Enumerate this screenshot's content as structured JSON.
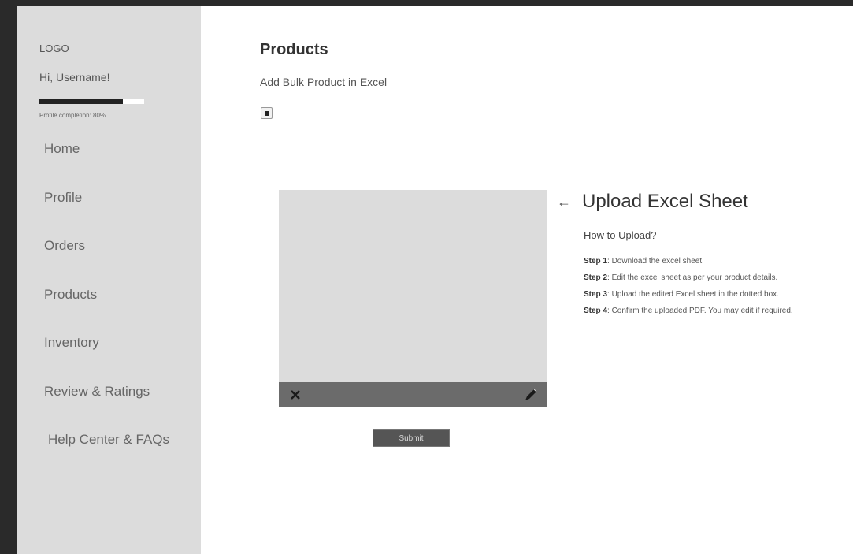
{
  "sidebar": {
    "logo": "LOGO",
    "greeting": "Hi, Username!",
    "profile_completion": {
      "value": 0.8,
      "label": "Profile completion: 80%"
    },
    "nav": [
      {
        "label": "Home"
      },
      {
        "label": "Profile"
      },
      {
        "label": "Orders"
      },
      {
        "label": "Products"
      },
      {
        "label": "Inventory"
      },
      {
        "label": "Review & Ratings"
      },
      {
        "label": "Help Center & FAQs"
      }
    ]
  },
  "main": {
    "title": "Products",
    "subtitle": "Add Bulk Product in Excel",
    "upload": {
      "heading": "Upload Excel Sheet",
      "how_to": "How to Upload?",
      "steps": [
        {
          "label": "Step 1",
          "text": "Download the excel sheet."
        },
        {
          "label": "Step 2",
          "text": "Edit the excel sheet as per your product details."
        },
        {
          "label": "Step 3",
          "text": "Upload the edited Excel sheet in the dotted box."
        },
        {
          "label": "Step 4",
          "text": "Confirm the uploaded PDF. You may edit if required."
        }
      ]
    },
    "submit_label": "Submit"
  },
  "icons": {
    "back": "left-arrow-icon",
    "remove": "close-icon",
    "edit": "pencil-icon",
    "checkbox": "checkbox-icon"
  }
}
